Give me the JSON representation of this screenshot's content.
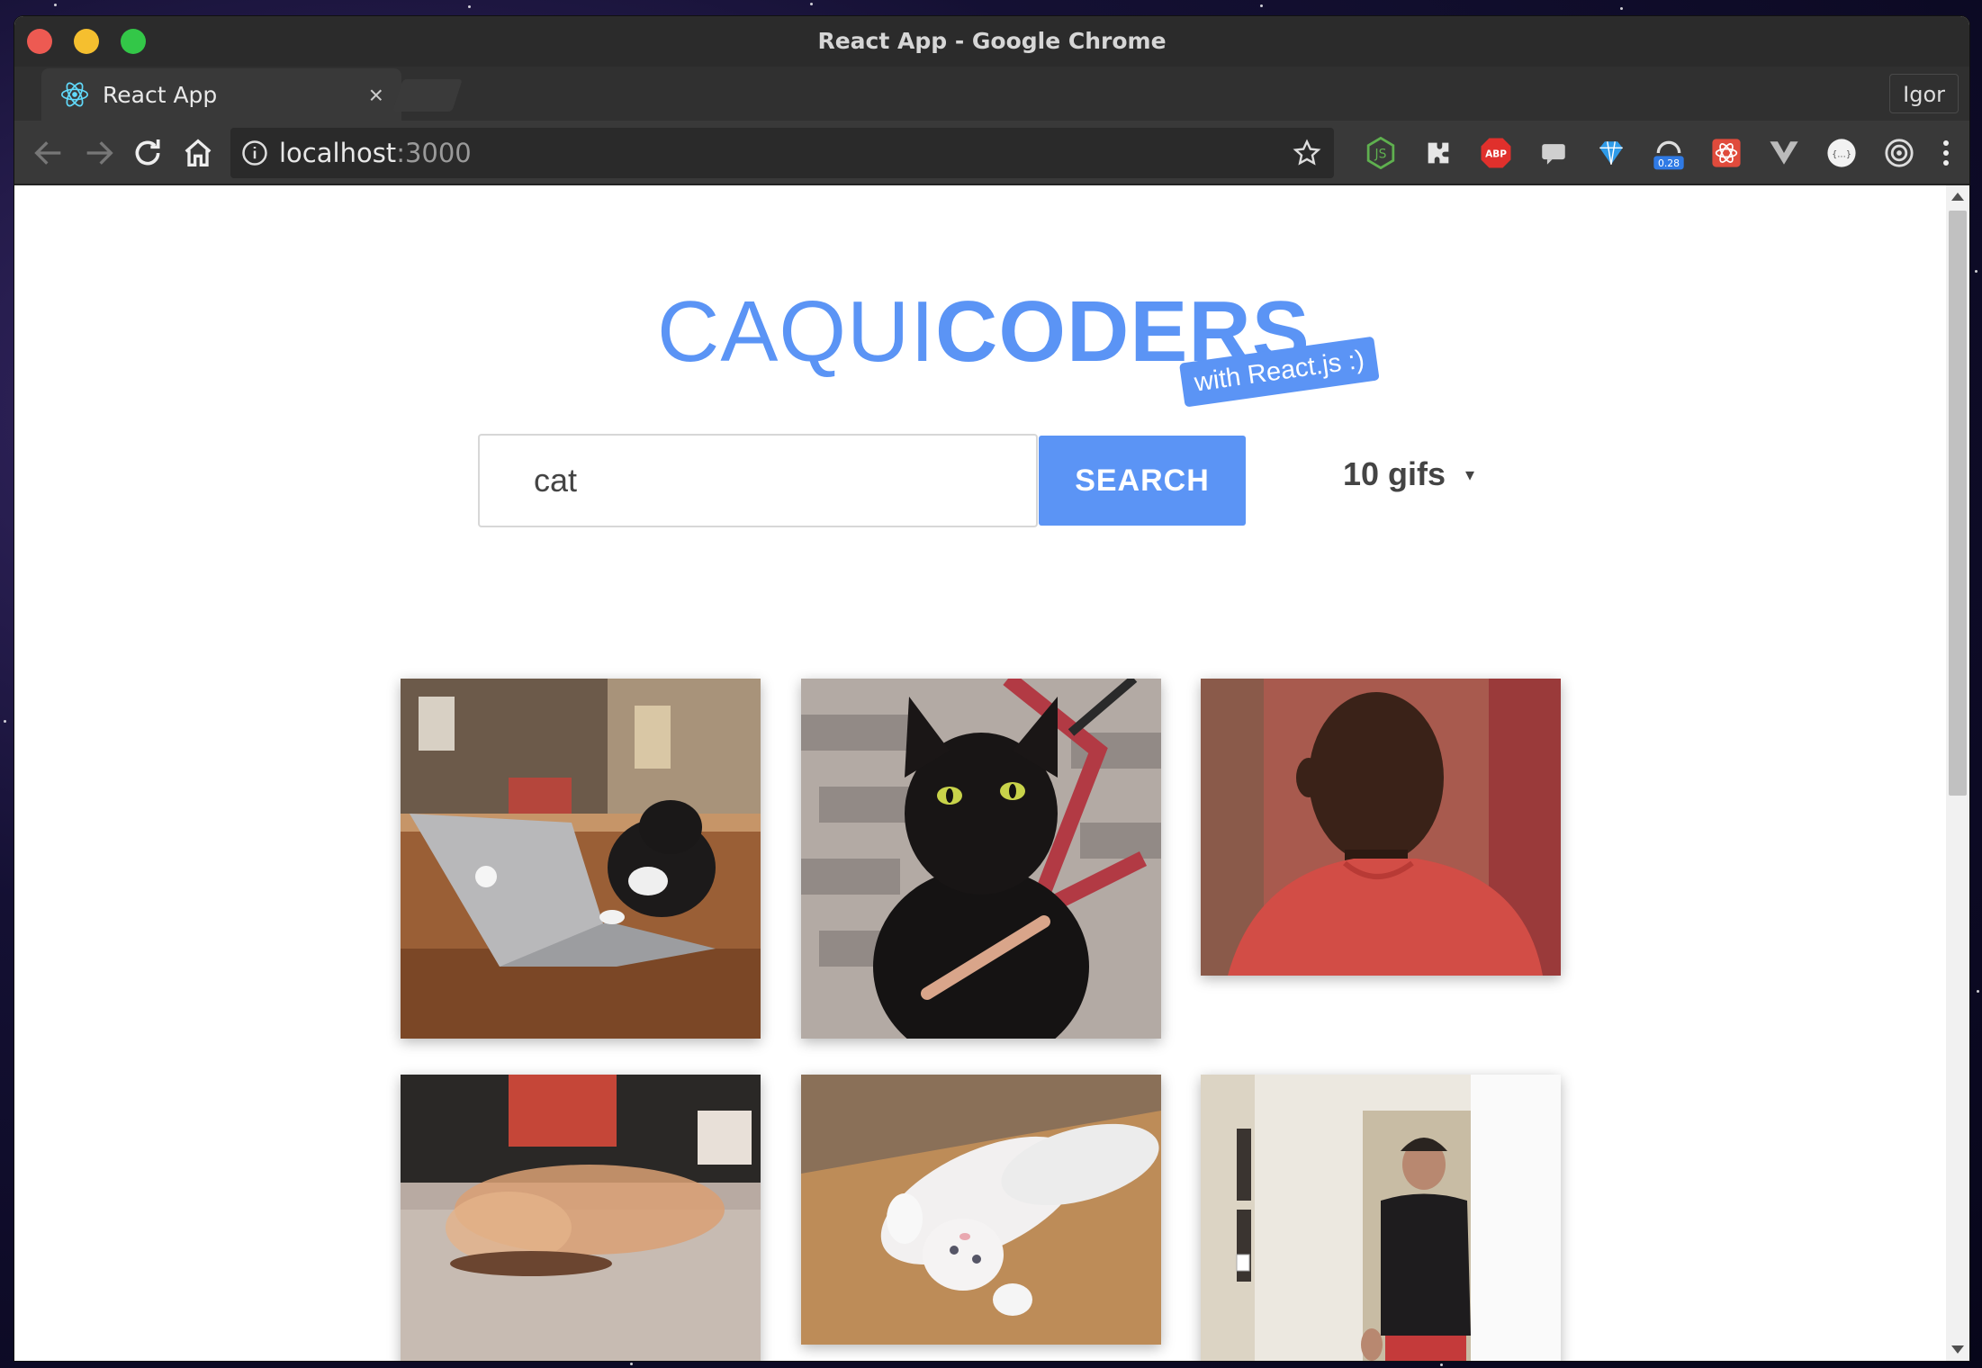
{
  "window": {
    "title": "React App - Google Chrome"
  },
  "tab": {
    "title": "React App",
    "close_label": "×"
  },
  "profile": {
    "name": "Igor"
  },
  "address_bar": {
    "host": "localhost",
    "port": ":3000"
  },
  "extensions": [
    {
      "name": "nodejs-extension-icon"
    },
    {
      "name": "puzzle-extension-icon"
    },
    {
      "name": "adblock-plus-icon",
      "label": "ABP"
    },
    {
      "name": "chat-extension-icon"
    },
    {
      "name": "diamond-extension-icon"
    },
    {
      "name": "speed-extension-icon",
      "badge": "0.28"
    },
    {
      "name": "react-devtools-icon"
    },
    {
      "name": "vue-devtools-icon"
    },
    {
      "name": "json-formatter-icon",
      "label": "{...}"
    },
    {
      "name": "target-extension-icon"
    }
  ],
  "app": {
    "logo_light": "CAQUI",
    "logo_bold": "CODERS",
    "badge": "with React.js :)",
    "search": {
      "value": "cat",
      "button_label": "SEARCH"
    },
    "count": {
      "value": "10 gifs",
      "arrow": "▾"
    }
  },
  "gifs": [
    {
      "name": "gif-cat-laptop",
      "subject": "cat typing on laptop"
    },
    {
      "name": "gif-black-cat-nail-file",
      "subject": "black cat with nail file"
    },
    {
      "name": "gif-man-red-shirt",
      "subject": "man in red shirt"
    },
    {
      "name": "gif-blurry-hand",
      "subject": "blurred hand and slipper"
    },
    {
      "name": "gif-white-cat-floor",
      "subject": "white cat rolling on floor"
    },
    {
      "name": "gif-man-hallway",
      "subject": "man in hallway"
    }
  ],
  "colors": {
    "accent": "#5b94f5"
  }
}
